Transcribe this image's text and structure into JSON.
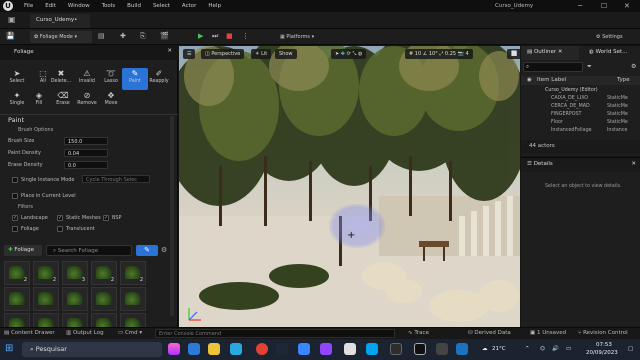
{
  "menu": {
    "items": [
      "File",
      "Edit",
      "Window",
      "Tools",
      "Build",
      "Select",
      "Actor",
      "Help"
    ]
  },
  "window": {
    "title": "Curso_Udemy"
  },
  "tabs": {
    "project_tab": "Curso_Udemy•"
  },
  "toolbar": {
    "mode": "Foliage Mode",
    "platforms": "Platforms",
    "settings": "Settings"
  },
  "foliage": {
    "title": "Foliage",
    "tools": [
      {
        "label": "Select",
        "icon": "cursor-icon"
      },
      {
        "label": "All",
        "icon": "select-all-icon"
      },
      {
        "label": "Delete...",
        "icon": "delete-icon"
      },
      {
        "label": "Invalid",
        "icon": "invalid-icon"
      },
      {
        "label": "Lasso",
        "icon": "lasso-icon"
      },
      {
        "label": "Paint",
        "icon": "paint-brush-icon",
        "active": true
      },
      {
        "label": "Reapply",
        "icon": "reapply-icon"
      },
      {
        "label": "Single",
        "icon": "single-icon"
      },
      {
        "label": "Fill",
        "icon": "fill-icon"
      },
      {
        "label": "Erase",
        "icon": "erase-icon"
      },
      {
        "label": "Remove",
        "icon": "remove-icon"
      },
      {
        "label": "Move",
        "icon": "move-icon"
      }
    ],
    "paint_title": "Paint",
    "brush_options": "Brush Options",
    "brush_size": {
      "label": "Brush Size",
      "value": "150.0"
    },
    "paint_density": {
      "label": "Paint Density",
      "value": "0.04"
    },
    "erase_density": {
      "label": "Erase Density",
      "value": "0.0"
    },
    "single_instance": {
      "label": "Single Instance Mode",
      "value": "Cycle Through Selec"
    },
    "place_current_level": "Place in Current Level",
    "filters_title": "Filters",
    "filters": [
      {
        "label": "Landscape",
        "checked": true
      },
      {
        "label": "Static Meshes",
        "checked": true
      },
      {
        "label": "BSP",
        "checked": true
      },
      {
        "label": "Foliage",
        "checked": false
      },
      {
        "label": "Translucent",
        "checked": false
      }
    ],
    "add_button": "Foliage",
    "search_placeholder": "Search Foliage",
    "thumbs": [
      "2",
      "2",
      "3",
      "2",
      "2",
      "",
      "",
      "",
      "",
      "",
      "1",
      "2",
      "3",
      "2",
      "2"
    ]
  },
  "viewport": {
    "perspective": "Perspective",
    "lit": "Lit",
    "show": "Show",
    "snap_values": [
      "10",
      "10°",
      "0.25"
    ],
    "camera_speed": "4"
  },
  "outliner": {
    "tab1": "Outliner",
    "tab2": "World Set...",
    "col_label": "Item Label",
    "col_type": "Type",
    "rows": [
      {
        "label": "Curso_Udemy (Editor)",
        "type": ""
      },
      {
        "label": "CAIXA_DE_LIXO",
        "type": "StaticMe"
      },
      {
        "label": "CERCA_DE_MAD",
        "type": "StaticMe"
      },
      {
        "label": "FINGERPOST",
        "type": "StaticMe"
      },
      {
        "label": "Floor",
        "type": "StaticMe"
      },
      {
        "label": "InstancedFoliage",
        "type": "Instance"
      }
    ],
    "count": "44 actors"
  },
  "details": {
    "title": "Details",
    "empty": "Select an object to view details."
  },
  "bottom": {
    "content_drawer": "Content Drawer",
    "output_log": "Output Log",
    "cmd": "Cmd",
    "console_placeholder": "Enter Console Command",
    "trace": "Trace",
    "derived_data": "Derived Data",
    "unsaved": "1 Unsaved",
    "revision": "Revision Control"
  },
  "taskbar": {
    "search": "Pesquisar",
    "temp": "21°C",
    "time": "07:53",
    "date": "20/09/2023"
  }
}
